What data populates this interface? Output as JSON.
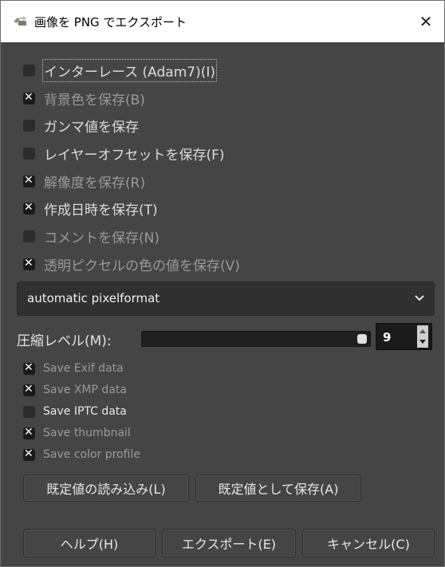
{
  "window": {
    "title": "画像を PNG でエクスポート",
    "close_glyph": "✕"
  },
  "options": [
    {
      "label": "インターレース (Adam7)(I)",
      "checked": false
    },
    {
      "label": "背景色を保存(B)",
      "checked": true
    },
    {
      "label": "ガンマ値を保存",
      "checked": false
    },
    {
      "label": "レイヤーオフセットを保存(F)",
      "checked": false
    },
    {
      "label": "解像度を保存(R)",
      "checked": true
    },
    {
      "label": "作成日時を保存(T)",
      "checked": true
    },
    {
      "label": "コメントを保存(N)",
      "checked": false
    },
    {
      "label": "透明ピクセルの色の値を保存(V)",
      "checked": true
    }
  ],
  "pixelformat": {
    "value": "automatic pixelformat"
  },
  "compression": {
    "label": "圧縮レベル(M):",
    "value": "9",
    "max": 9
  },
  "metadata": [
    {
      "label": "Save Exif data",
      "checked": true
    },
    {
      "label": "Save XMP data",
      "checked": true
    },
    {
      "label": "Save IPTC data",
      "checked": false
    },
    {
      "label": "Save thumbnail",
      "checked": true
    },
    {
      "label": "Save color profile",
      "checked": true
    }
  ],
  "buttons": {
    "load_defaults": "既定値の読み込み(L)",
    "save_defaults": "既定値として保存(A)",
    "help": "ヘルプ(H)",
    "export": "エクスポート(E)",
    "cancel": "キャンセル(C)"
  },
  "icons": {
    "app": "gimp-export-icon",
    "close": "close-icon",
    "check": "check-x-icon",
    "dropdown": "chevron-down-icon"
  }
}
